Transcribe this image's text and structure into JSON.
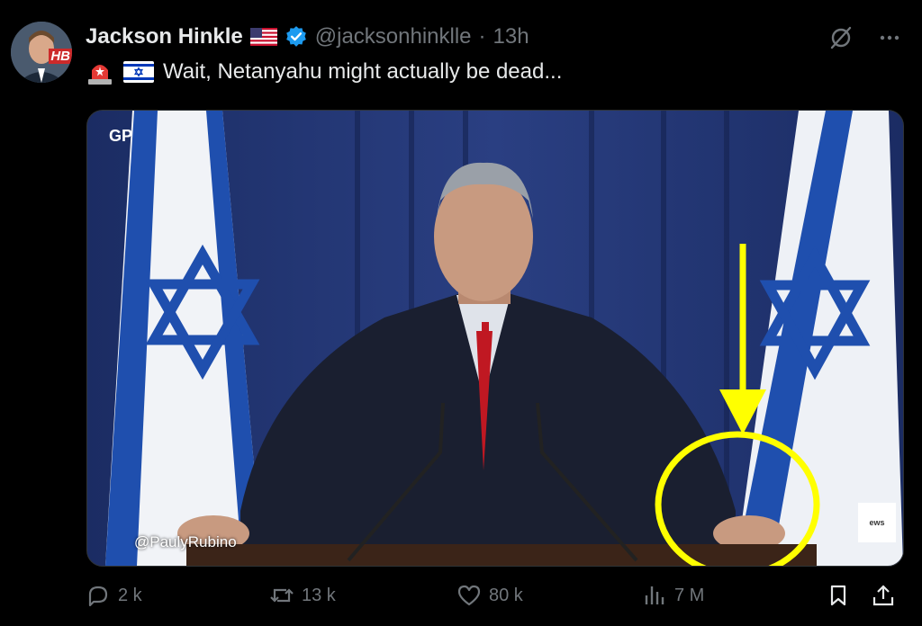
{
  "author": {
    "name": "Jackson Hinkle",
    "avatar_badge": "HB",
    "handle": "@jacksonhinklle",
    "separator": "·",
    "time": "13h",
    "verified_color": "#1d9bf0"
  },
  "tweet": {
    "text": "Wait, Netanyahu might actually be dead..."
  },
  "media": {
    "watermark": "@PaulyRubino",
    "logo_text": "GP",
    "badge_text": "ews"
  },
  "actions": {
    "replies": "2 k",
    "reposts": "13 k",
    "likes": "80 k",
    "views": "7 M"
  },
  "colors": {
    "background": "#000000",
    "text": "#e7e9ea",
    "muted": "#71767b",
    "accent": "#1d9bf0",
    "annotation": "#ffff00"
  },
  "icons": [
    "grok-icon",
    "more-icon",
    "reply-icon",
    "repost-icon",
    "like-icon",
    "views-icon",
    "bookmark-icon",
    "share-icon"
  ]
}
